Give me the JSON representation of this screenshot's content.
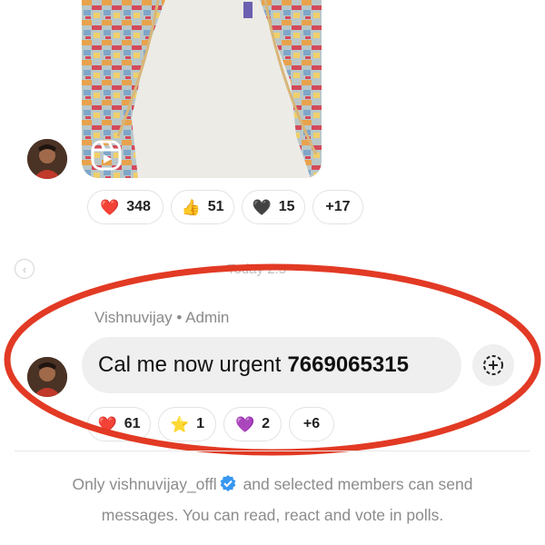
{
  "reel_message": {
    "reactions": [
      {
        "emoji": "❤️",
        "icon": "red-heart-icon",
        "count": "348"
      },
      {
        "emoji": "👍",
        "icon": "thumbs-up-icon",
        "count": "51"
      },
      {
        "emoji": "🖤",
        "icon": "black-heart-icon",
        "count": "15"
      },
      {
        "emoji": "",
        "icon": "",
        "count": "+17"
      }
    ]
  },
  "date_separator": "Today 2:5",
  "message": {
    "sender": "Vishnuvijay",
    "role": "Admin",
    "separator": "•",
    "text": "Cal me now urgent",
    "phone": "7669065315",
    "reactions": [
      {
        "emoji": "❤️",
        "icon": "red-heart-icon",
        "count": "61"
      },
      {
        "emoji": "⭐",
        "icon": "star-icon",
        "count": "1"
      },
      {
        "emoji": "💜",
        "icon": "purple-heart-icon",
        "count": "2"
      },
      {
        "emoji": "",
        "icon": "",
        "count": "+6"
      }
    ]
  },
  "notice": {
    "prefix": "Only",
    "username": "vishnuvijay_offl",
    "line1_suffix": "and selected members can send",
    "line2": "messages. You can read, react and vote in polls."
  },
  "colors": {
    "annotation_red": "#e23a24",
    "bubble_bg": "#efefef",
    "verified_blue": "#3897f0"
  }
}
